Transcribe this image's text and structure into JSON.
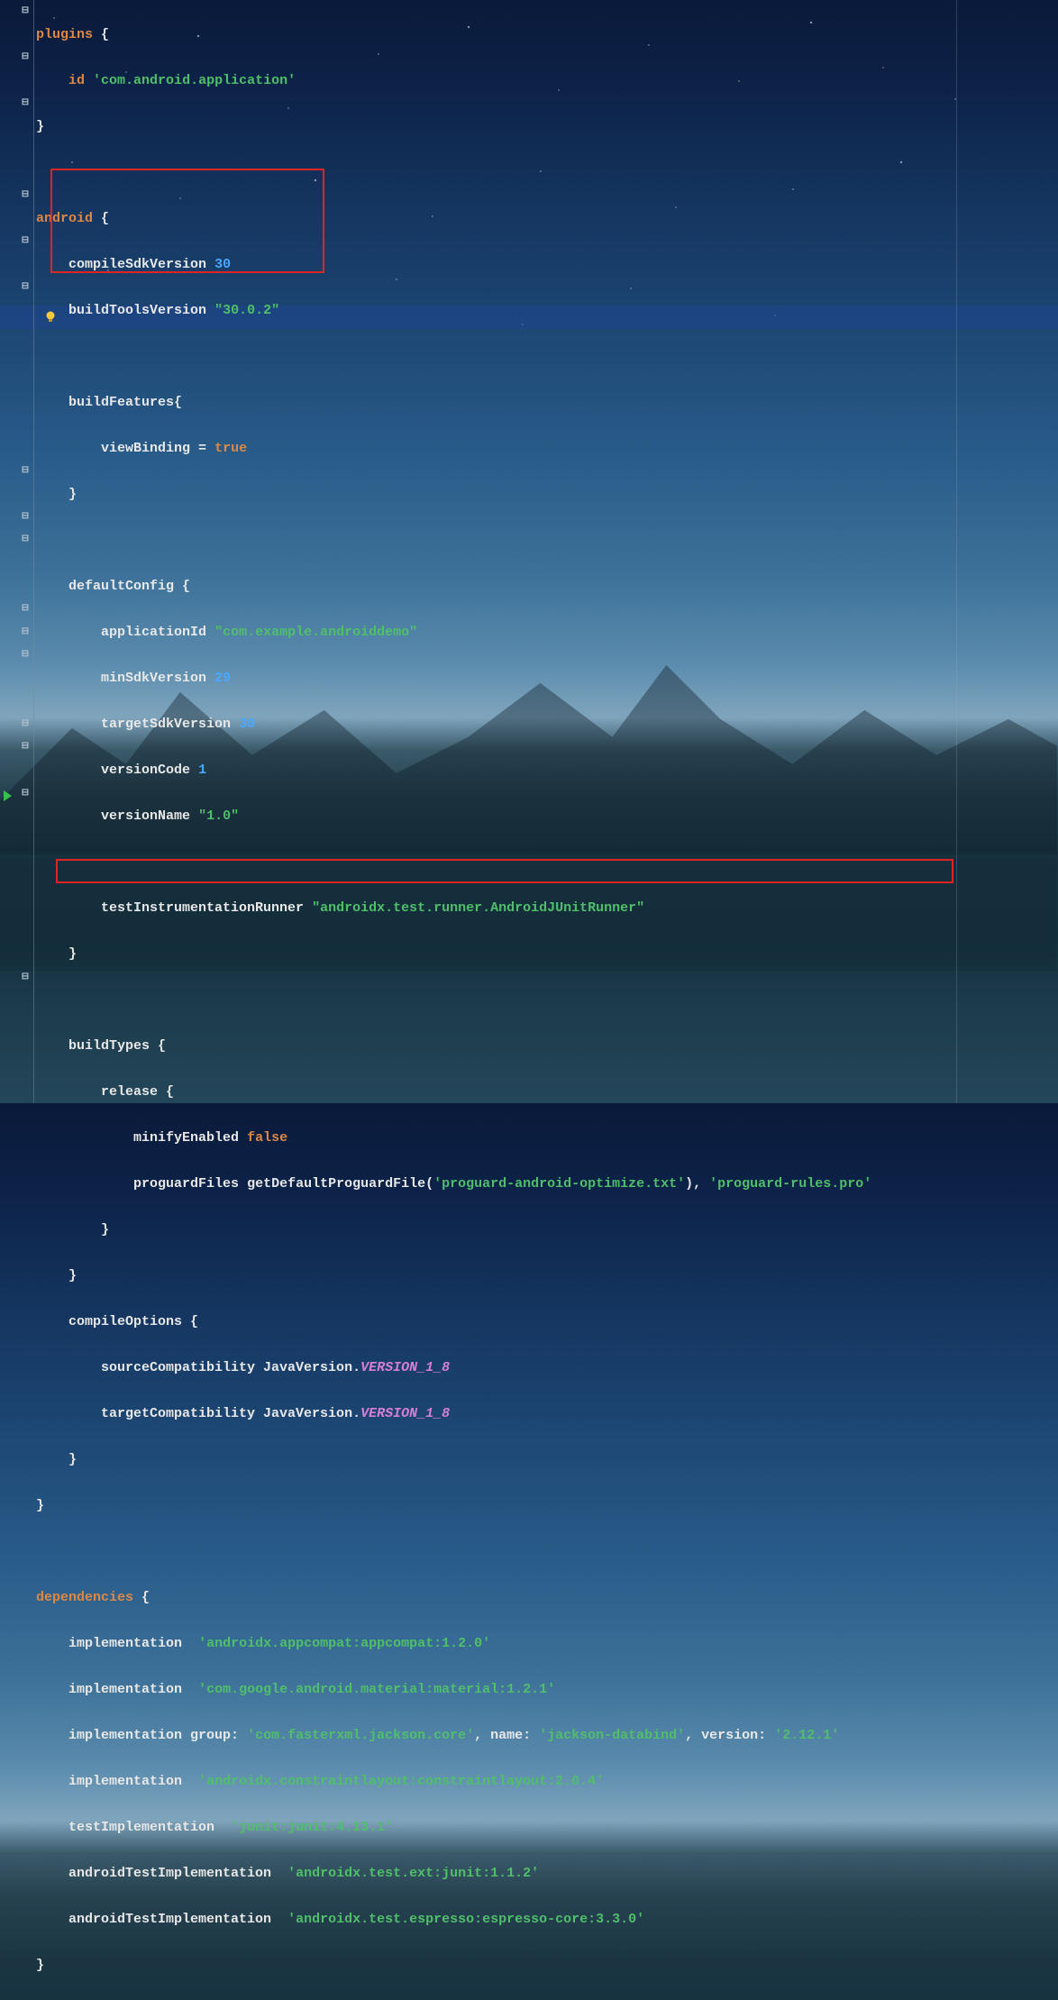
{
  "blocks": {
    "plugins_kw": "plugins",
    "plugins_open": " {",
    "id_kw": "id",
    "id_val": "'com.android.application'",
    "close": "}",
    "android_kw": "android",
    "android_open": " {",
    "compileSdk_kw": "compileSdkVersion",
    "compileSdk_val": "30",
    "buildTools_kw": "buildToolsVersion",
    "buildTools_val": "\"30.0.2\"",
    "buildFeatures_kw": "buildFeatures",
    "buildFeatures_open": "{",
    "viewBinding_kw": "viewBinding",
    "equals": " = ",
    "true_lit": "true",
    "defaultConfig_kw": "defaultConfig",
    "defaultConfig_open": " {",
    "applicationId_kw": "applicationId",
    "applicationId_val": "\"com.example.androiddemo\"",
    "minSdk_kw": "minSdkVersion",
    "minSdk_val": "29",
    "targetSdk_kw": "targetSdkVersion",
    "targetSdk_val": "30",
    "versionCode_kw": "versionCode",
    "versionCode_val": "1",
    "versionName_kw": "versionName",
    "versionName_val": "\"1.0\"",
    "testRunner_kw": "testInstrumentationRunner",
    "testRunner_val": "\"androidx.test.runner.AndroidJUnitRunner\"",
    "buildTypes_kw": "buildTypes",
    "buildTypes_open": " {",
    "release_kw": "release",
    "release_open": " {",
    "minify_kw": "minifyEnabled",
    "false_lit": "false",
    "proguard_kw": "proguardFiles",
    "proguard_call": " getDefaultProguardFile(",
    "proguard_arg1": "'proguard-android-optimize.txt'",
    "proguard_mid": "), ",
    "proguard_arg2": "'proguard-rules.pro'",
    "compileOptions_kw": "compileOptions",
    "compileOptions_open": " {",
    "srcCompat_kw": "sourceCompatibility",
    "javaVersion": " JavaVersion.",
    "version18": "VERSION_1_8",
    "tgtCompat_kw": "targetCompatibility",
    "dependencies_kw": "dependencies",
    "dependencies_open": " {",
    "impl_kw": "implementation",
    "testImpl_kw": "testImplementation",
    "andTestImpl_kw": "androidTestImplementation",
    "dep1": "'androidx.appcompat:appcompat:1.2.0'",
    "dep2": "'com.google.android.material:material:1.2.1'",
    "group_kw": " group: ",
    "dep3_group": "'com.fasterxml.jackson.core'",
    "name_kw": ", name: ",
    "dep3_name": "'jackson-databind'",
    "version_kw": ", version: ",
    "dep3_ver": "'2.12.1'",
    "dep4": "'androidx.constraintlayout:constraintlayout:2.0.4'",
    "dep5": "'junit:junit:4.13.1'",
    "dep6": "'androidx.test.ext:junit:1.1.2'",
    "dep7": "'androidx.test.espresso:espresso-core:3.3.0'"
  },
  "indent": {
    "i1": "    ",
    "i2": "        ",
    "i3": "            "
  }
}
